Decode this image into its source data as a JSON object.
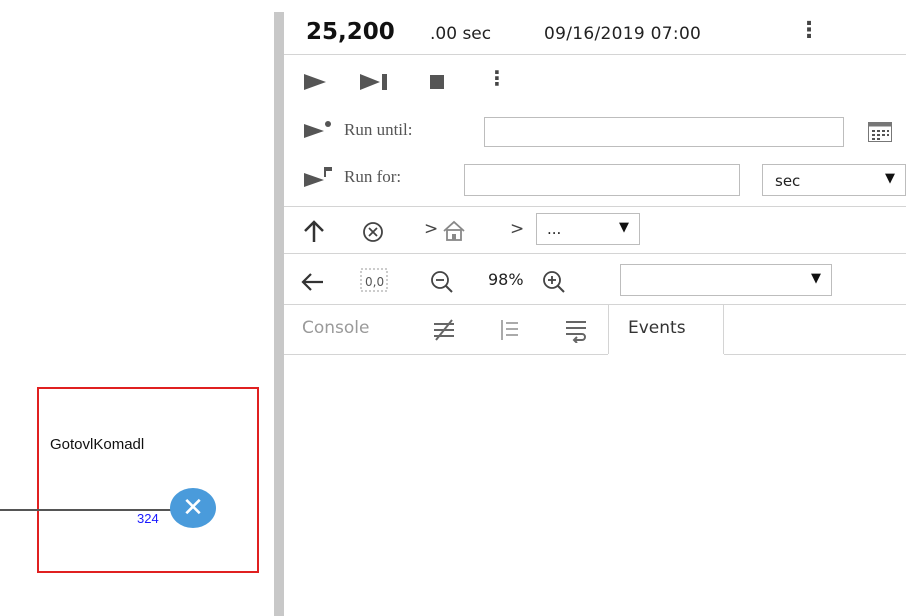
{
  "model": {
    "sink_name": "GotovlKomadl",
    "sink_count": "324",
    "sink_icon": "close-x-icon"
  },
  "time_bar": {
    "time_main": "25,200",
    "time_decimals": ".00 sec",
    "date": "09/16/2019 07:00",
    "more_icon": "kebab-icon"
  },
  "controls": {
    "icons": [
      "play-icon",
      "step-icon",
      "stop-icon",
      "kebab-icon"
    ]
  },
  "run_until": {
    "label": "Run until:",
    "value": "",
    "calendar_icon": "calendar-icon"
  },
  "run_for": {
    "label": "Run for:",
    "value": "",
    "unit": "sec"
  },
  "navigation": {
    "up_icon": "arrow-up-icon",
    "close_icon": "circle-x-icon",
    "home_icon": "home-icon",
    "path_select": "..."
  },
  "zoom": {
    "back_icon": "arrow-left-icon",
    "fit_icon": "zoom-fit-icon",
    "level": "98%",
    "view_select": ""
  },
  "tabs": {
    "console": "Console",
    "events": "Events"
  },
  "colors": {
    "accent_orange": "#f2a800",
    "sink_blue": "#4a9bdb",
    "sink_border": "#e02020",
    "count_blue": "#1a1aff"
  }
}
